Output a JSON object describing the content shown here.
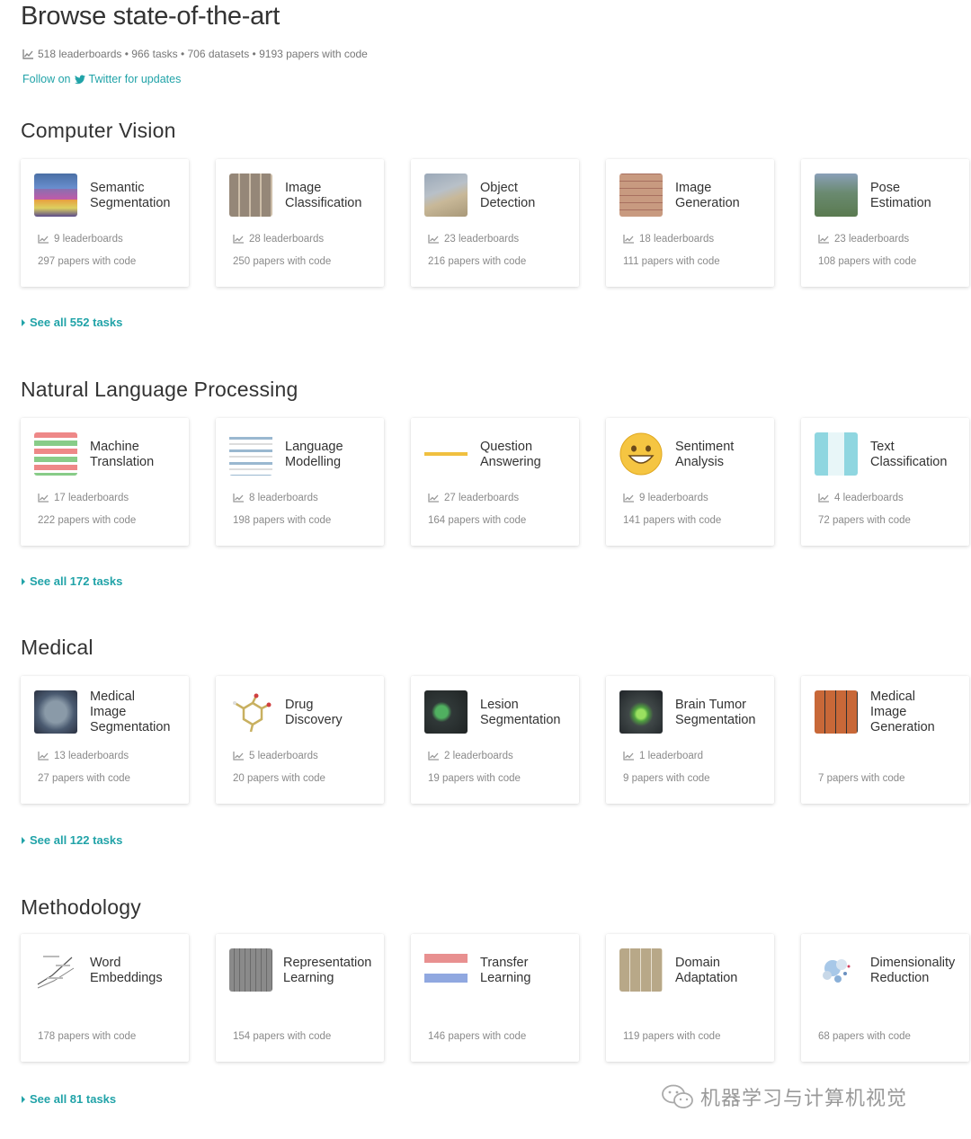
{
  "header": {
    "title": "Browse state-of-the-art",
    "stats": "518 leaderboards • 966 tasks • 706 datasets • 9193 papers with code",
    "follow_prefix": "Follow on",
    "follow_suffix": "Twitter for updates"
  },
  "accent_color": "#21a3a8",
  "sections": [
    {
      "title": "Computer Vision",
      "see_all": "See all 552 tasks",
      "cards": [
        {
          "title": "Semantic\nSegmentation",
          "leaderboards": "9 leaderboards",
          "papers": "297 papers with code",
          "thumb": "segmentation-thumb"
        },
        {
          "title": "Image\nClassification",
          "leaderboards": "28 leaderboards",
          "papers": "250 papers with code",
          "thumb": "image-grid-thumb"
        },
        {
          "title": "Object\nDetection",
          "leaderboards": "23 leaderboards",
          "papers": "216 papers with code",
          "thumb": "street-photo-thumb"
        },
        {
          "title": "Image\nGeneration",
          "leaderboards": "18 leaderboards",
          "papers": "111 papers with code",
          "thumb": "face-grid-thumb"
        },
        {
          "title": "Pose\nEstimation",
          "leaderboards": "23 leaderboards",
          "papers": "108 papers with code",
          "thumb": "athlete-photo-thumb"
        }
      ]
    },
    {
      "title": "Natural Language Processing",
      "see_all": "See all 172 tasks",
      "cards": [
        {
          "title": "Machine\nTranslation",
          "leaderboards": "17 leaderboards",
          "papers": "222 papers with code",
          "thumb": "translation-diagram-thumb"
        },
        {
          "title": "Language\nModelling",
          "leaderboards": "8 leaderboards",
          "papers": "198 papers with code",
          "thumb": "lm-diagram-thumb"
        },
        {
          "title": "Question\nAnswering",
          "leaderboards": "27 leaderboards",
          "papers": "164 papers with code",
          "thumb": "text-doc-thumb"
        },
        {
          "title": "Sentiment\nAnalysis",
          "leaderboards": "9 leaderboards",
          "papers": "141 papers with code",
          "thumb": "smiley-thumb"
        },
        {
          "title": "Text\nClassification",
          "leaderboards": "4 leaderboards",
          "papers": "72 papers with code",
          "thumb": "text-class-thumb"
        }
      ]
    },
    {
      "title": "Medical",
      "see_all": "See all 122 tasks",
      "cards": [
        {
          "title": "Medical\nImage\nSegmentation",
          "leaderboards": "13 leaderboards",
          "papers": "27 papers with code",
          "thumb": "brain-scan-thumb"
        },
        {
          "title": "Drug\nDiscovery",
          "leaderboards": "5 leaderboards",
          "papers": "20 papers with code",
          "thumb": "molecule-thumb"
        },
        {
          "title": "Lesion\nSegmentation",
          "leaderboards": "2 leaderboards",
          "papers": "19 papers with code",
          "thumb": "lesion-scan-thumb"
        },
        {
          "title": "Brain Tumor\nSegmentation",
          "leaderboards": "1 leaderboard",
          "papers": "9 papers with code",
          "thumb": "tumor-scan-thumb"
        },
        {
          "title": "Medical\nImage\nGeneration",
          "leaderboards": "",
          "papers": "7 papers with code",
          "thumb": "medical-grid-thumb"
        }
      ]
    },
    {
      "title": "Methodology",
      "see_all": "See all 81 tasks",
      "cards": [
        {
          "title": "Word\nEmbeddings",
          "leaderboards": "",
          "papers": "178 papers with code",
          "thumb": "embedding-plot-thumb"
        },
        {
          "title": "Representation\nLearning",
          "leaderboards": "",
          "papers": "154 papers with code",
          "thumb": "gray-grid-thumb"
        },
        {
          "title": "Transfer\nLearning",
          "leaderboards": "",
          "papers": "146 papers with code",
          "thumb": "transfer-diagram-thumb"
        },
        {
          "title": "Domain\nAdaptation",
          "leaderboards": "",
          "papers": "119 papers with code",
          "thumb": "domain-grid-thumb"
        },
        {
          "title": "Dimensionality\nReduction",
          "leaderboards": "",
          "papers": "68 papers with code",
          "thumb": "scatter-cloud-thumb"
        }
      ]
    }
  ],
  "watermark": "机器学习与计算机视觉"
}
